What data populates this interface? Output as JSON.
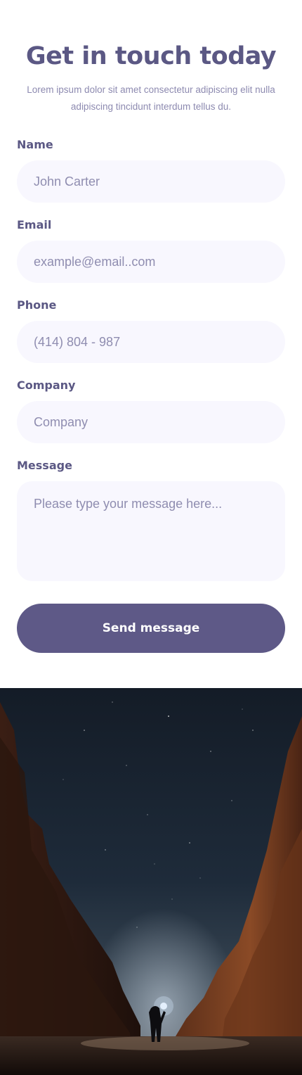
{
  "contact": {
    "title": "Get in touch today",
    "subtitle": "Lorem ipsum dolor sit amet consectetur adipiscing elit nulla adipiscing tincidunt interdum tellus du.",
    "fields": {
      "name": {
        "label": "Name",
        "placeholder": "John Carter"
      },
      "email": {
        "label": "Email",
        "placeholder": "example@email..com"
      },
      "phone": {
        "label": "Phone",
        "placeholder": "(414) 804 - 987"
      },
      "company": {
        "label": "Company",
        "placeholder": "Company"
      },
      "message": {
        "label": "Message",
        "placeholder": "Please type your message here..."
      }
    },
    "submit_label": "Send message"
  },
  "colors": {
    "heading": "#5b5884",
    "button": "#5e5987",
    "input_bg": "#f8f7fe",
    "placeholder": "#8f8db0"
  },
  "photo": {
    "subject": "night-sky-canyon-with-person-holding-light"
  }
}
